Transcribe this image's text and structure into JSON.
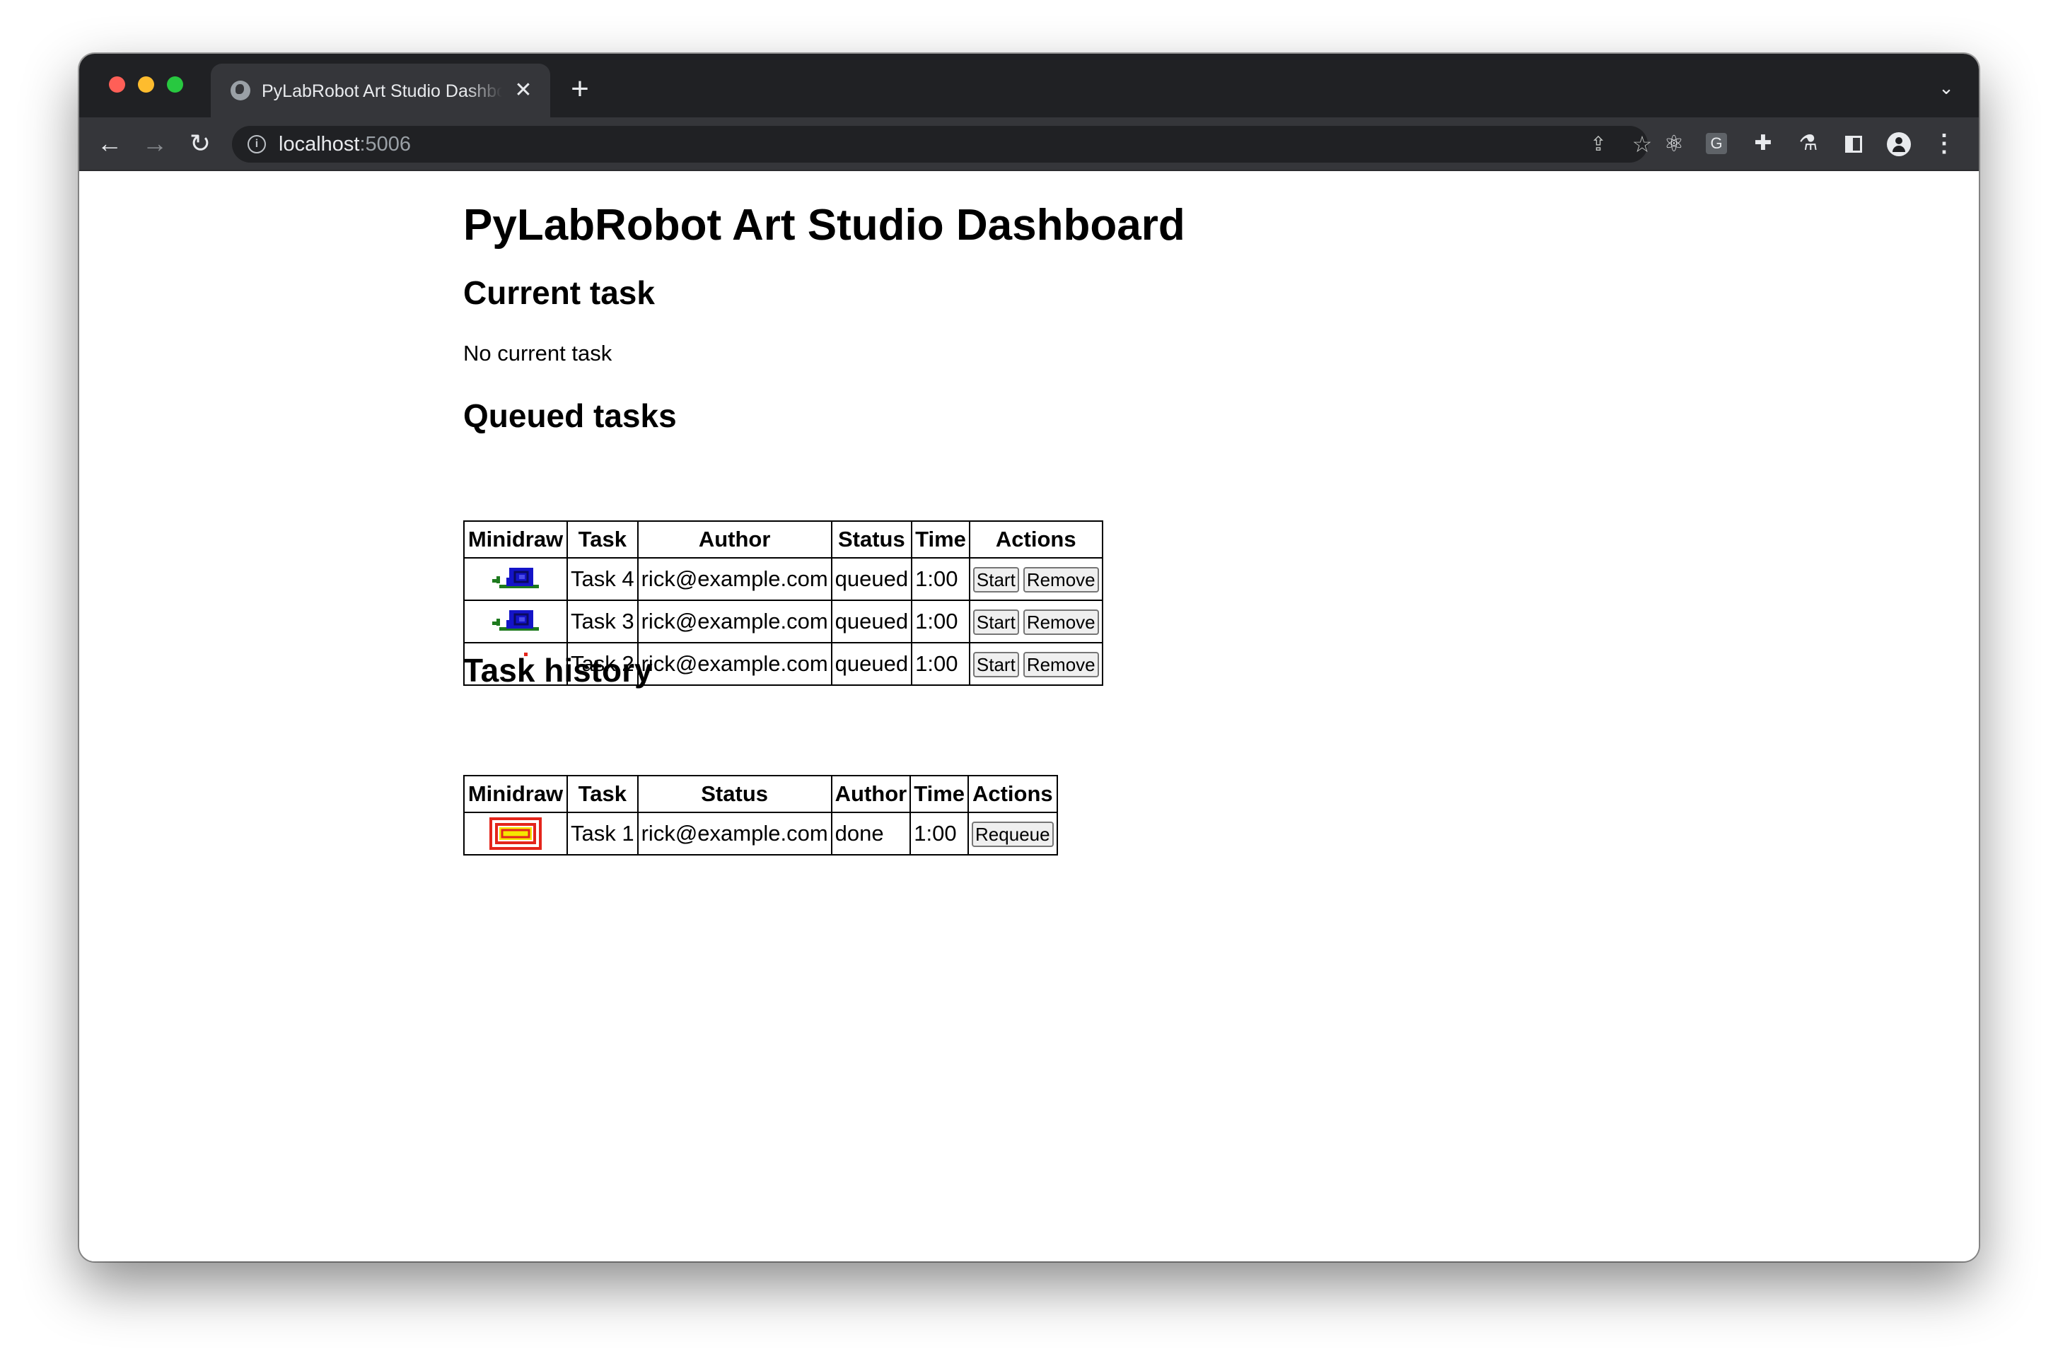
{
  "browser": {
    "tab_title": "PyLabRobot Art Studio Dashboard",
    "tab_close": "✕",
    "new_tab": "+",
    "url_host": "localhost",
    "url_port": ":5006",
    "extensions_icon_letter": "G"
  },
  "page": {
    "title": "PyLabRobot Art Studio Dashboard",
    "current_task": {
      "heading": "Current task",
      "text": "No current task"
    },
    "queued": {
      "heading": "Queued tasks",
      "columns": [
        "Minidraw",
        "Task",
        "Author",
        "Status",
        "Time",
        "Actions"
      ],
      "rows": [
        {
          "task": "Task 4",
          "author": "rick@example.com",
          "status": "queued",
          "time": "1:00",
          "minidraw": "snail-drawing"
        },
        {
          "task": "Task 3",
          "author": "rick@example.com",
          "status": "queued",
          "time": "1:00",
          "minidraw": "snail-drawing"
        },
        {
          "task": "Task 2",
          "author": "rick@example.com",
          "status": "queued",
          "time": "1:00",
          "minidraw": "red-dot-drawing"
        }
      ],
      "start_label": "Start",
      "remove_label": "Remove"
    },
    "history": {
      "heading": "Task history",
      "columns": [
        "Minidraw",
        "Task",
        "Status",
        "Author",
        "Time",
        "Actions"
      ],
      "rows": [
        {
          "task": "Task 1",
          "author": "rick@example.com",
          "status": "done",
          "time": "1:00",
          "minidraw": "spiral-drawing"
        }
      ],
      "requeue_label": "Requeue"
    }
  },
  "colors": {
    "snail_blue": "#1414c8",
    "snail_green": "#1e7a1e",
    "spiral_red": "#e4251b",
    "spiral_yellow": "#f5e600",
    "dot_red": "#e4251b"
  }
}
